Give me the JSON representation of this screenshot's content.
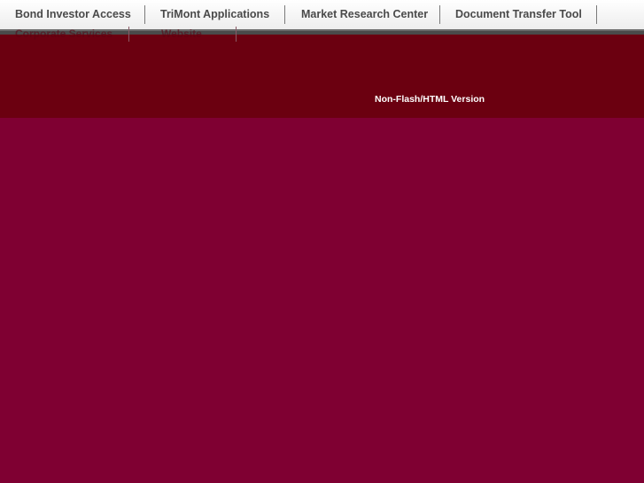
{
  "nav": {
    "items": [
      {
        "label": "Bond Investor Access"
      },
      {
        "label": "TriMont Applications"
      },
      {
        "label": "Market Research Center"
      },
      {
        "label": "Document Transfer Tool"
      }
    ],
    "overflow_items": [
      {
        "label": "Corporate Services"
      },
      {
        "label": "Website"
      }
    ]
  },
  "header": {
    "nonflash_link": "Non-Flash/HTML Version"
  },
  "colors": {
    "header_band": "#6b0010",
    "page_background": "#7f0032",
    "nav_text": "#4a4a4a"
  }
}
